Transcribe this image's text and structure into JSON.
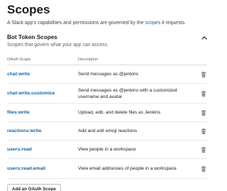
{
  "page": {
    "title": "Scopes",
    "intro_before": "A Slack app's capabilities and permissions are governed by the ",
    "intro_link": "scopes",
    "intro_after": " it requests."
  },
  "section": {
    "title": "Bot Token Scopes",
    "subtitle": "Scopes that govern what your app can access."
  },
  "table": {
    "col_scope": "OAuth Scope",
    "col_desc": "Description",
    "rows": [
      {
        "scope": "chat:write",
        "description": "Send messages as @jenkins"
      },
      {
        "scope": "chat:write.customize",
        "description": "Send messages as @jenkins with a customized username and avatar"
      },
      {
        "scope": "files:write",
        "description": "Upload, edit, and delete files as Jenkins"
      },
      {
        "scope": "reactions:write",
        "description": "Add and edit emoji reactions"
      },
      {
        "scope": "users:read",
        "description": "View people in a workspace"
      },
      {
        "scope": "users:read.email",
        "description": "View email addresses of people in a workspace"
      }
    ]
  },
  "add_button": "Add an OAuth Scope",
  "colors": {
    "link": "#1264a3",
    "text": "#1d1c1d",
    "muted": "#616061"
  },
  "icons": {
    "collapse": "chevron-up-icon",
    "remove": "trash-icon"
  }
}
